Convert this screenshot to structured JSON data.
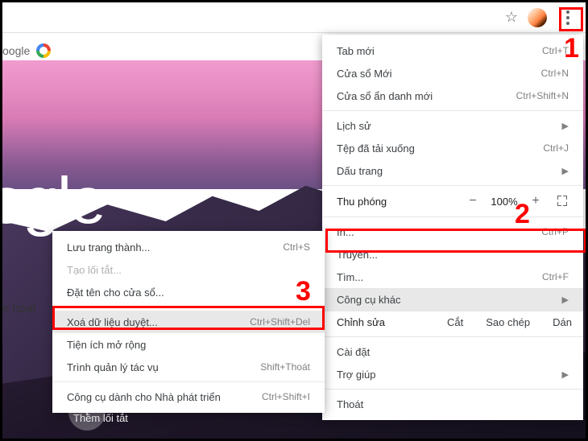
{
  "page": {
    "address_partial": "oogle",
    "big_logo_partial": "oogle",
    "left_text_partial": "e hoạt",
    "shortcut_label": "Thêm lối tắt",
    "shortcut_icon_glyph": "+"
  },
  "toolbar": {
    "star_glyph": "☆"
  },
  "main_menu": {
    "items": [
      {
        "label": "Tab mới",
        "shortcut": "Ctrl+T"
      },
      {
        "label": "Cửa sổ Mới",
        "shortcut": "Ctrl+N"
      },
      {
        "label": "Cửa sổ ẩn danh mới",
        "shortcut": "Ctrl+Shift+N"
      }
    ],
    "section2": [
      {
        "label": "Lịch sử",
        "arrow": true
      },
      {
        "label": "Tệp đã tải xuống",
        "shortcut": "Ctrl+J"
      },
      {
        "label": "Dấu trang",
        "arrow": true
      }
    ],
    "zoom": {
      "label": "Thu phóng",
      "minus": "−",
      "value": "100%",
      "plus": "+"
    },
    "section3": [
      {
        "label": "In...",
        "shortcut": "Ctrl+P"
      },
      {
        "label": "Truyền..."
      },
      {
        "label": "Tìm...",
        "shortcut": "Ctrl+F"
      },
      {
        "label": "Công cụ khác",
        "arrow": true,
        "highlight": true
      }
    ],
    "edit": {
      "label": "Chỉnh sửa",
      "cut": "Cắt",
      "copy": "Sao chép",
      "paste": "Dán"
    },
    "section4": [
      {
        "label": "Cài đặt"
      },
      {
        "label": "Trợ giúp",
        "arrow": true
      }
    ],
    "section5": [
      {
        "label": "Thoát"
      }
    ]
  },
  "sub_menu": {
    "items": [
      {
        "label": "Lưu trang thành...",
        "shortcut": "Ctrl+S"
      },
      {
        "label": "Tạo lối tắt...",
        "disabled": true
      },
      {
        "label": "Đặt tên cho cửa sổ..."
      }
    ],
    "items2": [
      {
        "label": "Xoá dữ liệu duyệt...",
        "shortcut": "Ctrl+Shift+Del",
        "highlight": true
      },
      {
        "label": "Tiện ích mở rộng"
      },
      {
        "label": "Trình quản lý tác vụ",
        "shortcut": "Shift+Thoát"
      }
    ],
    "items3": [
      {
        "label": "Công cụ dành cho Nhà phát triển",
        "shortcut": "Ctrl+Shift+I"
      }
    ]
  },
  "annotations": {
    "n1": "1",
    "n2": "2",
    "n3": "3"
  }
}
